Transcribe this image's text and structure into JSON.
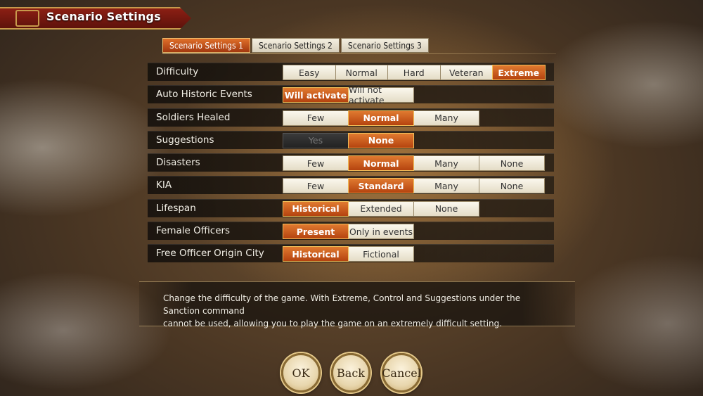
{
  "header": {
    "title": "Scenario Settings"
  },
  "tabs": [
    {
      "label": "Scenario Settings 1",
      "active": true
    },
    {
      "label": "Scenario Settings 2",
      "active": false
    },
    {
      "label": "Scenario Settings 3",
      "active": false
    }
  ],
  "settings": [
    {
      "label": "Difficulty",
      "options": [
        "Easy",
        "Normal",
        "Hard",
        "Veteran",
        "Extreme"
      ],
      "selected": "Extreme"
    },
    {
      "label": "Auto Historic Events",
      "options": [
        "Will activate",
        "Will not activate"
      ],
      "selected": "Will activate"
    },
    {
      "label": "Soldiers Healed",
      "options": [
        "Few",
        "Normal",
        "Many"
      ],
      "selected": "Normal"
    },
    {
      "label": "Suggestions",
      "options": [
        "Yes",
        "None"
      ],
      "selected": "None",
      "disabled": [
        "Yes"
      ]
    },
    {
      "label": "Disasters",
      "options": [
        "Few",
        "Normal",
        "Many",
        "None"
      ],
      "selected": "Normal"
    },
    {
      "label": "KIA",
      "options": [
        "Few",
        "Standard",
        "Many",
        "None"
      ],
      "selected": "Standard"
    },
    {
      "label": "Lifespan",
      "options": [
        "Historical",
        "Extended",
        "None"
      ],
      "selected": "Historical"
    },
    {
      "label": "Female Officers",
      "options": [
        "Present",
        "Only in events"
      ],
      "selected": "Present"
    },
    {
      "label": "Free Officer Origin City",
      "options": [
        "Historical",
        "Fictional"
      ],
      "selected": "Historical"
    }
  ],
  "description": {
    "line1": "Change the difficulty of the game. With Extreme, Control and Suggestions under the Sanction command",
    "line2": "cannot be used, allowing you to play the game on an extremely difficult setting."
  },
  "buttons": {
    "ok": "OK",
    "back": "Back",
    "cancel": "Cancel"
  },
  "colors": {
    "accent": "#c2501a",
    "banner": "#7a1a10",
    "gold": "#c79a4c"
  }
}
